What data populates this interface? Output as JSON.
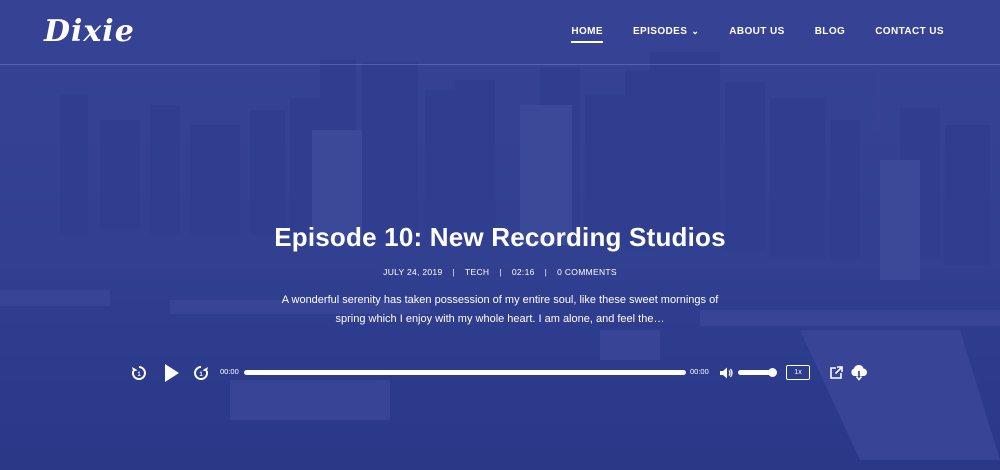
{
  "brand": {
    "logo_text": "Dixie"
  },
  "nav": {
    "items": [
      {
        "label": "HOME",
        "active": true
      },
      {
        "label": "EPISODES",
        "has_dropdown": true
      },
      {
        "label": "ABOUT US"
      },
      {
        "label": "BLOG"
      },
      {
        "label": "CONTACT US"
      }
    ]
  },
  "episode": {
    "title": "Episode 10: New Recording Studios",
    "date": "JULY 24, 2019",
    "category": "TECH",
    "duration": "02:16",
    "comments": "0 COMMENTS",
    "excerpt": "A wonderful serenity has taken possession of my entire soul, like these sweet mornings of spring which I enjoy with my whole heart. I am alone, and feel the…"
  },
  "player": {
    "current_time": "00:00",
    "total_time": "00:00",
    "speed": "1x",
    "progress": 0,
    "volume": 1.0,
    "icons": [
      "rewind-icon",
      "play-icon",
      "forward-icon",
      "volume-icon",
      "share-icon",
      "download-icon"
    ]
  },
  "colors": {
    "overlay": "#26348c",
    "text": "#ffffff"
  }
}
